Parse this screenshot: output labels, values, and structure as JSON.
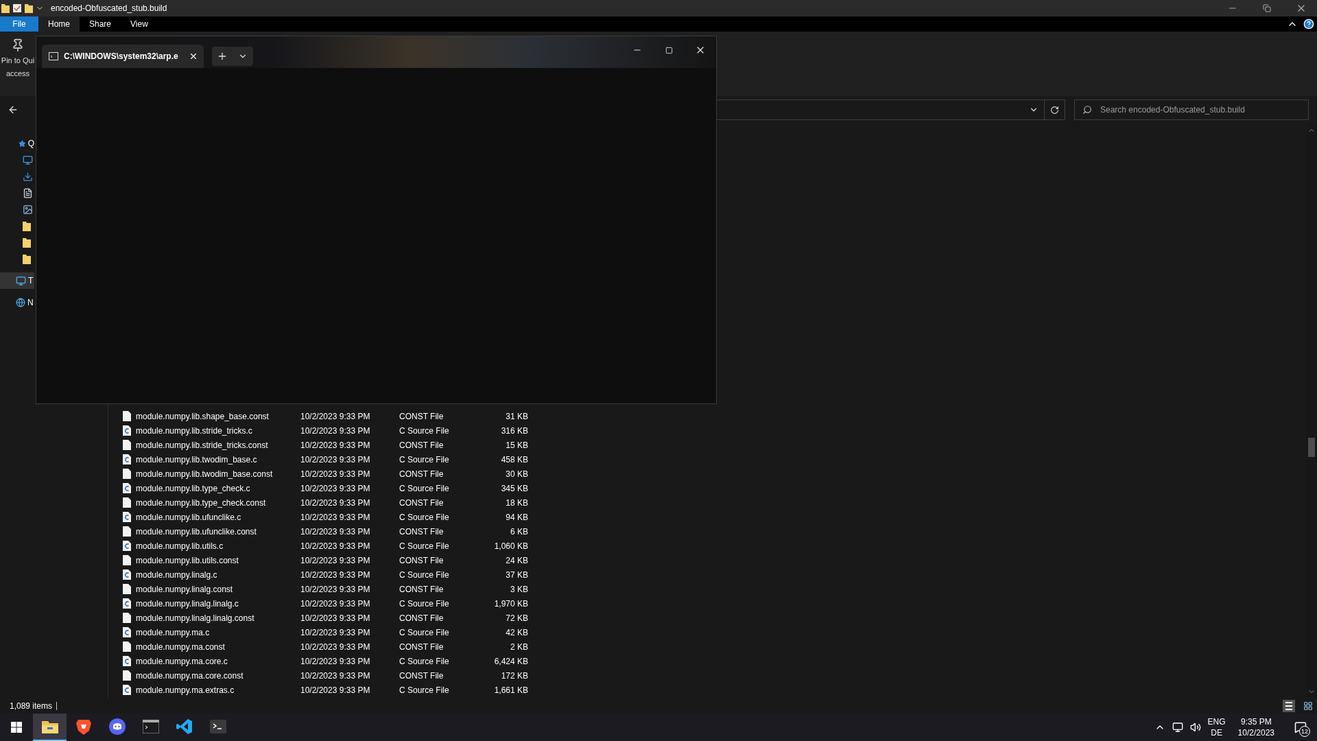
{
  "window": {
    "title": "encoded-Obfuscated_stub.build"
  },
  "ribbon_tabs": [
    {
      "label": "File",
      "kind": "file",
      "selected": false
    },
    {
      "label": "Home",
      "kind": "tab",
      "selected": true
    },
    {
      "label": "Share",
      "kind": "tab",
      "selected": false
    },
    {
      "label": "View",
      "kind": "tab",
      "selected": false
    }
  ],
  "ribbon": {
    "pin_button": {
      "lines": [
        "Pin to Qui",
        "access"
      ]
    }
  },
  "address": {
    "search": {
      "placeholder": "Search encoded-Obfuscated_stub.build"
    }
  },
  "nav": [
    {
      "label": "Q",
      "kind": "star",
      "selected": false
    },
    {
      "kind": "desktop",
      "selected": false
    },
    {
      "kind": "download",
      "selected": false
    },
    {
      "kind": "document",
      "selected": false
    },
    {
      "kind": "picture",
      "selected": false
    },
    {
      "kind": "folder",
      "selected": false
    },
    {
      "kind": "folder",
      "selected": false
    },
    {
      "kind": "folder",
      "selected": false
    },
    {
      "label": "T",
      "kind": "pc",
      "selected": true
    },
    {
      "label": "N",
      "kind": "network",
      "selected": false
    }
  ],
  "files": [
    {
      "name": "module.numpy.lib.shape_base.const",
      "kind": "const",
      "date": "10/2/2023 9:33 PM",
      "type": "CONST File",
      "size": "31 KB"
    },
    {
      "name": "module.numpy.lib.stride_tricks.c",
      "kind": "c",
      "date": "10/2/2023 9:33 PM",
      "type": "C Source File",
      "size": "316 KB"
    },
    {
      "name": "module.numpy.lib.stride_tricks.const",
      "kind": "const",
      "date": "10/2/2023 9:33 PM",
      "type": "CONST File",
      "size": "15 KB"
    },
    {
      "name": "module.numpy.lib.twodim_base.c",
      "kind": "c",
      "date": "10/2/2023 9:33 PM",
      "type": "C Source File",
      "size": "458 KB"
    },
    {
      "name": "module.numpy.lib.twodim_base.const",
      "kind": "const",
      "date": "10/2/2023 9:33 PM",
      "type": "CONST File",
      "size": "30 KB"
    },
    {
      "name": "module.numpy.lib.type_check.c",
      "kind": "c",
      "date": "10/2/2023 9:33 PM",
      "type": "C Source File",
      "size": "345 KB"
    },
    {
      "name": "module.numpy.lib.type_check.const",
      "kind": "const",
      "date": "10/2/2023 9:33 PM",
      "type": "CONST File",
      "size": "18 KB"
    },
    {
      "name": "module.numpy.lib.ufunclike.c",
      "kind": "c",
      "date": "10/2/2023 9:33 PM",
      "type": "C Source File",
      "size": "94 KB"
    },
    {
      "name": "module.numpy.lib.ufunclike.const",
      "kind": "const",
      "date": "10/2/2023 9:33 PM",
      "type": "CONST File",
      "size": "6 KB"
    },
    {
      "name": "module.numpy.lib.utils.c",
      "kind": "c",
      "date": "10/2/2023 9:33 PM",
      "type": "C Source File",
      "size": "1,060 KB"
    },
    {
      "name": "module.numpy.lib.utils.const",
      "kind": "const",
      "date": "10/2/2023 9:33 PM",
      "type": "CONST File",
      "size": "24 KB"
    },
    {
      "name": "module.numpy.linalg.c",
      "kind": "c",
      "date": "10/2/2023 9:33 PM",
      "type": "C Source File",
      "size": "37 KB"
    },
    {
      "name": "module.numpy.linalg.const",
      "kind": "const",
      "date": "10/2/2023 9:33 PM",
      "type": "CONST File",
      "size": "3 KB"
    },
    {
      "name": "module.numpy.linalg.linalg.c",
      "kind": "c",
      "date": "10/2/2023 9:33 PM",
      "type": "C Source File",
      "size": "1,970 KB"
    },
    {
      "name": "module.numpy.linalg.linalg.const",
      "kind": "const",
      "date": "10/2/2023 9:33 PM",
      "type": "CONST File",
      "size": "72 KB"
    },
    {
      "name": "module.numpy.ma.c",
      "kind": "c",
      "date": "10/2/2023 9:33 PM",
      "type": "C Source File",
      "size": "42 KB"
    },
    {
      "name": "module.numpy.ma.const",
      "kind": "const",
      "date": "10/2/2023 9:33 PM",
      "type": "CONST File",
      "size": "2 KB"
    },
    {
      "name": "module.numpy.ma.core.c",
      "kind": "c",
      "date": "10/2/2023 9:33 PM",
      "type": "C Source File",
      "size": "6,424 KB"
    },
    {
      "name": "module.numpy.ma.core.const",
      "kind": "const",
      "date": "10/2/2023 9:33 PM",
      "type": "CONST File",
      "size": "172 KB"
    },
    {
      "name": "module.numpy.ma.extras.c",
      "kind": "c",
      "date": "10/2/2023 9:33 PM",
      "type": "C Source File",
      "size": "1,661 KB"
    }
  ],
  "status_bar": {
    "count": "1,089 items"
  },
  "terminal": {
    "tab_title": "C:\\WINDOWS\\system32\\arp.e"
  },
  "taskbar": {
    "apps": [
      {
        "kind": "explorer",
        "active": true
      },
      {
        "kind": "brave",
        "active": false
      },
      {
        "kind": "discord",
        "active": false
      },
      {
        "kind": "cmd",
        "active": false
      },
      {
        "kind": "vscode",
        "active": false
      },
      {
        "kind": "terminal",
        "active": false
      }
    ],
    "language": "ENG",
    "layout": "DE",
    "time": "9:35 PM",
    "date": "10/2/2023",
    "notifications": "12"
  }
}
